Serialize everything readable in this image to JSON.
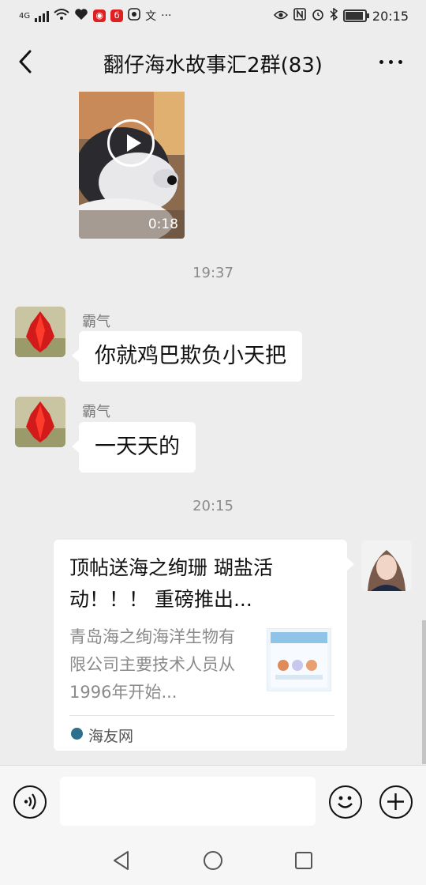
{
  "status_bar": {
    "network": "4G",
    "extra_icon": "文",
    "more": "···",
    "time": "20:15",
    "battery_level": 0.85
  },
  "header": {
    "title": "翻仔海水故事汇2群(83)"
  },
  "video_message": {
    "duration": "0:18"
  },
  "timestamps": [
    "19:37",
    "20:15"
  ],
  "messages": [
    {
      "sender": "霸气",
      "text": "你就鸡巴欺负小天把"
    },
    {
      "sender": "霸气",
      "text": "一天天的"
    }
  ],
  "shared_card": {
    "title": "顶帖送海之绚珊 瑚盐活动！！！ 重磅推出...",
    "description": "青岛海之绚海洋生物有限公司主要技术人员从1996年开始...",
    "source": "海友网"
  },
  "input_bar": {
    "placeholder": ""
  },
  "icons": {
    "back": "back-arrow-icon",
    "more": "more-icon",
    "voice": "voice-icon",
    "emoji": "emoji-icon",
    "plus": "plus-icon"
  },
  "colors": {
    "background": "#ededed",
    "bubble": "#ffffff",
    "timestamp": "#8a8a8a"
  }
}
